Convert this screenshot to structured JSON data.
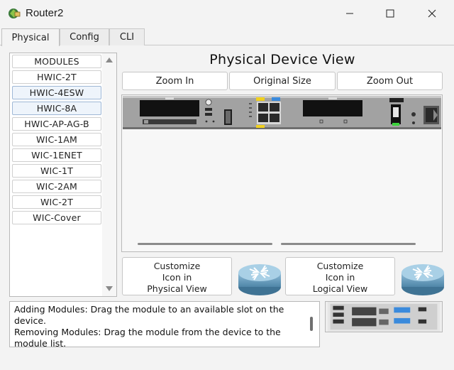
{
  "window": {
    "title": "Router2"
  },
  "tabs": [
    {
      "label": "Physical",
      "active": true
    },
    {
      "label": "Config",
      "active": false
    },
    {
      "label": "CLI",
      "active": false
    }
  ],
  "modules": {
    "items": [
      {
        "label": "MODULES"
      },
      {
        "label": "HWIC-2T"
      },
      {
        "label": "HWIC-4ESW",
        "selected": true
      },
      {
        "label": "HWIC-8A",
        "selected": true
      },
      {
        "label": "HWIC-AP-AG-B"
      },
      {
        "label": "WIC-1AM"
      },
      {
        "label": "WIC-1ENET"
      },
      {
        "label": "WIC-1T"
      },
      {
        "label": "WIC-2AM"
      },
      {
        "label": "WIC-2T"
      },
      {
        "label": "WIC-Cover"
      }
    ]
  },
  "view": {
    "title": "Physical Device View",
    "zoom_in": "Zoom In",
    "original_size": "Original Size",
    "zoom_out": "Zoom Out"
  },
  "customize": {
    "physical": [
      "Customize",
      "Icon in",
      "Physical View"
    ],
    "logical": [
      "Customize",
      "Icon in",
      "Logical View"
    ]
  },
  "info": {
    "line1": "Adding Modules: Drag the module to an available slot on the device.",
    "line2": "Removing Modules: Drag the module from the device to the module list."
  },
  "colors": {
    "router_blue": "#6fa3c4",
    "device_body": "#9a9a9a",
    "led_green": "#3cd33c"
  },
  "icons": {
    "app": "packet-tracer-icon",
    "router": "router-icon",
    "minimize": "minimize-icon",
    "maximize": "maximize-icon",
    "close": "close-icon"
  }
}
